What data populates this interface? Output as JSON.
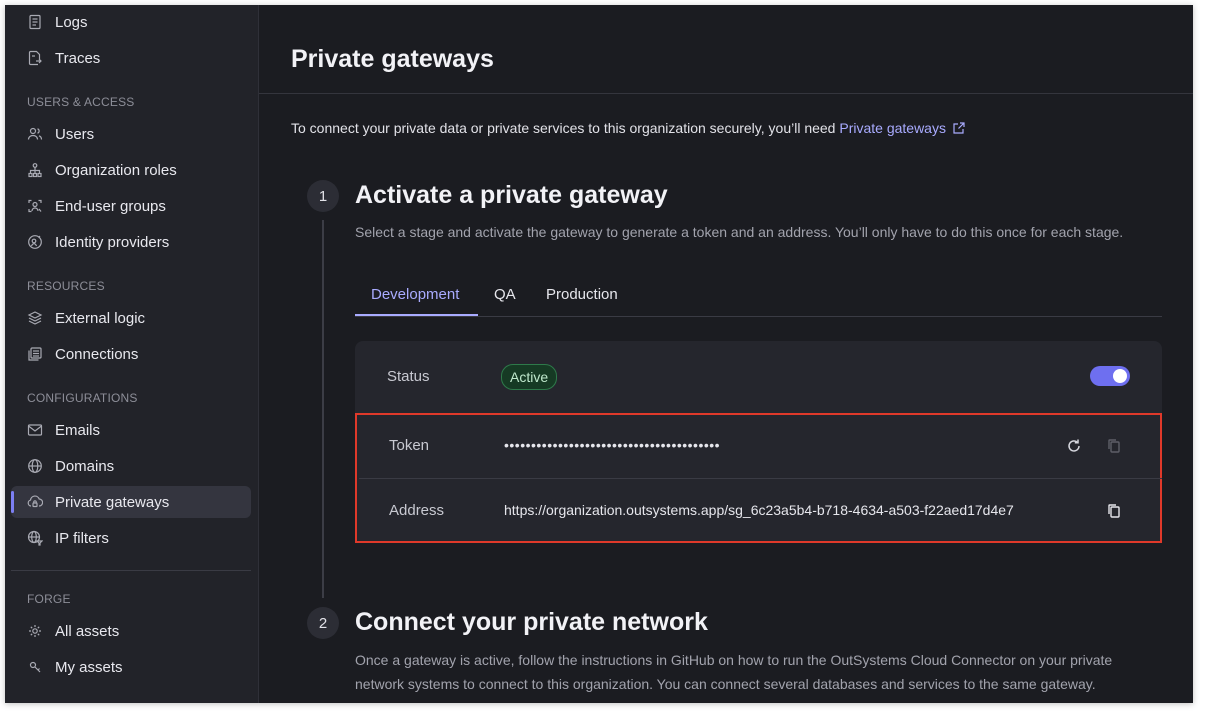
{
  "sidebar": {
    "top_items": [
      {
        "label": "Logs",
        "icon": "document-icon"
      },
      {
        "label": "Traces",
        "icon": "trace-icon"
      }
    ],
    "sections": [
      {
        "heading": "USERS & ACCESS",
        "items": [
          {
            "label": "Users",
            "icon": "users-icon"
          },
          {
            "label": "Organization roles",
            "icon": "org-tree-icon"
          },
          {
            "label": "End-user groups",
            "icon": "user-group-icon"
          },
          {
            "label": "Identity providers",
            "icon": "identity-icon"
          }
        ]
      },
      {
        "heading": "RESOURCES",
        "items": [
          {
            "label": "External logic",
            "icon": "layers-icon"
          },
          {
            "label": "Connections",
            "icon": "database-icon"
          }
        ]
      },
      {
        "heading": "CONFIGURATIONS",
        "items": [
          {
            "label": "Emails",
            "icon": "mail-icon"
          },
          {
            "label": "Domains",
            "icon": "globe-icon"
          },
          {
            "label": "Private gateways",
            "icon": "cloud-lock-icon",
            "active": true
          },
          {
            "label": "IP filters",
            "icon": "globe-filter-icon"
          }
        ]
      },
      {
        "heading": "FORGE",
        "items": [
          {
            "label": "All assets",
            "icon": "asset-icon"
          },
          {
            "label": "My assets",
            "icon": "my-asset-icon"
          }
        ]
      }
    ]
  },
  "page": {
    "title": "Private gateways",
    "intro_text": "To connect your private data or private services to this organization securely, you’ll need ",
    "intro_link": "Private gateways"
  },
  "step1": {
    "number": "1",
    "title": "Activate a private gateway",
    "description": "Select a stage and activate the gateway to generate a token and an address. You’ll only have to do this once for each stage.",
    "tabs": [
      "Development",
      "QA",
      "Production"
    ],
    "active_tab": "Development",
    "status_label": "Status",
    "status_value": "Active",
    "toggle_on": true,
    "token_label": "Token",
    "token_value": "••••••••••••••••••••••••••••••••••••••••",
    "address_label": "Address",
    "address_value": "https://organization.outsystems.app/sg_6c23a5b4-b718-4634-a503-f22aed17d4e7"
  },
  "step2": {
    "number": "2",
    "title": "Connect your private network",
    "description_line1": "Once a gateway is active, follow the instructions in GitHub on how to run the OutSystems Cloud Connector on your private",
    "description_line2": "network systems to connect to this organization. You can connect several databases and services to the same gateway."
  },
  "colors": {
    "accent": "#a9abff",
    "toggle": "#6e6ff0",
    "highlight_border": "#e0392a",
    "badge_bg": "#163a24"
  }
}
